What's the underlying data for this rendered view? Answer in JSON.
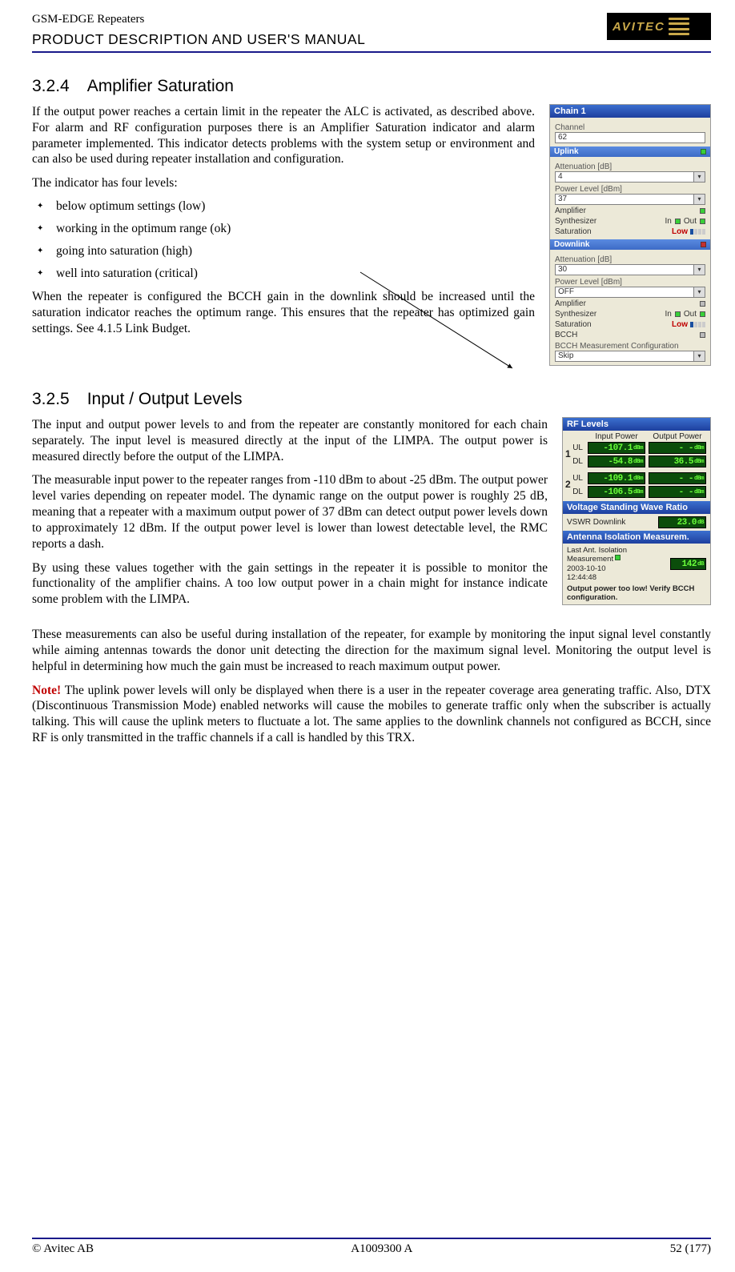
{
  "header": {
    "line1": "GSM-EDGE Repeaters",
    "line2": "PRODUCT DESCRIPTION AND USER'S MANUAL",
    "logo_text": "AVITEC"
  },
  "s1": {
    "num": "3.2.4",
    "title": "Amplifier Saturation",
    "p1": "If the output power reaches a certain limit in the repeater the ALC is activated, as described above. For alarm and RF configuration purposes there is an Amplifier Saturation indicator and alarm parameter implemented. This indicator detects problems with the system setup or environment and can also be used during repeater installation and configuration.",
    "p2": "The indicator has four levels:",
    "li1": "below optimum settings (low)",
    "li2": "working in the optimum range (ok)",
    "li3": "going into saturation (high)",
    "li4": "well into saturation (critical)",
    "p3": "When the repeater is configured the BCCH gain in the downlink should be increased until the saturation indicator reaches the optimum range. This ensures that the repeater has optimized gain settings. See 4.1.5 Link Budget."
  },
  "panel1": {
    "title": "Chain 1",
    "channel_label": "Channel",
    "channel_value": "62",
    "uplink": "Uplink",
    "att_label": "Attenuation [dB]",
    "att_value": "4",
    "pl_label": "Power Level [dBm]",
    "pl_value": "37",
    "amp": "Amplifier",
    "synth": "Synthesizer",
    "in": "In",
    "out": "Out",
    "sat": "Saturation",
    "low": "Low",
    "downlink": "Downlink",
    "dl_att_label": "Attenuation [dB]",
    "dl_att_value": "30",
    "dl_pl_label": "Power Level [dBm]",
    "dl_pl_value": "OFF",
    "bcch": "BCCH",
    "bcch_cfg": "BCCH Measurement Configuration",
    "bcch_cfg_value": "Skip"
  },
  "s2": {
    "num": "3.2.5",
    "title": "Input / Output Levels",
    "p1": "The input and output power levels to and from the repeater are constantly monitored for each chain separately. The input level is measured directly at the input of the LIMPA. The output power is measured directly before the output of the LIMPA.",
    "p2": "The measurable input power to the repeater ranges from -110 dBm to about -25 dBm. The output power level varies depending on repeater model. The dynamic range on the output power is roughly 25 dB, meaning that a repeater with a maximum output power of 37 dBm can detect output power levels down to approximately 12 dBm. If the output power level is lower than lowest detectable level, the RMC reports a dash.",
    "p3": "By using these values together with the gain settings in the repeater it is possible to monitor the functionality of the amplifier chains. A too low output power in a chain might for instance indicate some problem with the LIMPA.",
    "p4": "These measurements can also be useful during installation of the repeater, for example by monitoring the input signal level constantly while aiming antennas towards the donor unit detecting the direction for the maximum signal level. Monitoring the output level is helpful in determining how much the gain must be increased to reach maximum output power.",
    "note_label": "Note!",
    "p5": " The uplink power levels will only be displayed when there is a user in the repeater coverage area generating traffic. Also, DTX (Discontinuous Transmission Mode) enabled networks will cause the mobiles to generate traffic only when the subscriber is actually talking. This will cause the uplink meters to fluctuate a lot. The same applies to the downlink channels not configured as BCCH, since RF is only transmitted in the traffic channels if a call is handled by this TRX."
  },
  "panel2": {
    "rf_title": "RF Levels",
    "col_in": "Input Power",
    "col_out": "Output Power",
    "ul": "UL",
    "dl": "DL",
    "one": "1",
    "two": "2",
    "r1_ul_in": "-107.1",
    "r1_ul_out": "- -",
    "r1_dl_in": "-54.8",
    "r1_dl_out": "36.5",
    "r2_ul_in": "-109.1",
    "r2_ul_out": "- -",
    "r2_dl_in": "-106.5",
    "r2_dl_out": "- -",
    "unit_dbm": "dBm",
    "vswr_title": "Voltage Standing Wave Ratio",
    "vswr_label": "VSWR Downlink",
    "vswr_value": "23.0",
    "unit_db": "dB",
    "ant_title": "Antenna Isolation Measurem.",
    "ant_label": "Last Ant. Isolation Measurement",
    "ant_date": "2003-10-10",
    "ant_time": "12:44:48",
    "ant_value": "142",
    "ant_warn": "Output power too low! Verify BCCH configuration."
  },
  "footer": {
    "left": "© Avitec AB",
    "mid": "A1009300 A",
    "right": "52 (177)"
  }
}
